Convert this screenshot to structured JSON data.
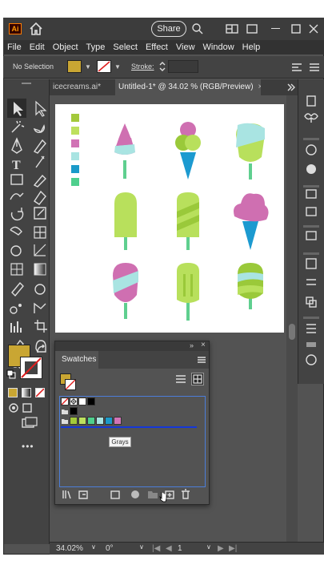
{
  "titlebar": {
    "app_logo": "Ai",
    "share_label": "Share"
  },
  "menu": [
    "File",
    "Edit",
    "Object",
    "Type",
    "Select",
    "Effect",
    "View",
    "Window",
    "Help"
  ],
  "control": {
    "selection_label": "No Selection",
    "stroke_label": "Stroke:",
    "fill_color": "#c9a633"
  },
  "tabs": [
    {
      "label": "icecreams.ai*",
      "close": "×"
    },
    {
      "label": "Untitled-1* @ 34.02 % (RGB/Preview)",
      "close": "×"
    }
  ],
  "artwork": {
    "palette": [
      "#a3c93b",
      "#bde05e",
      "#d173b5",
      "#a9e4e2",
      "#1b9ac9",
      "#4ecf8d"
    ],
    "colors": {
      "pink": "#cf6fb1",
      "lime": "#b8e05c",
      "green": "#9ac93a",
      "mint": "#a9e4e2",
      "blue": "#1c9ad0",
      "stick": "#5fcf8f"
    }
  },
  "swatches": {
    "title": "Swatches",
    "tooltip": "Grays",
    "group_colors": [
      "#a3c93b",
      "#bde05e",
      "#4ecf8d",
      "#a9e4e2",
      "#1b9ac9",
      "#d173b5"
    ]
  },
  "status": {
    "zoom": "34.02%",
    "rotation": "0°",
    "artboard": "1"
  }
}
